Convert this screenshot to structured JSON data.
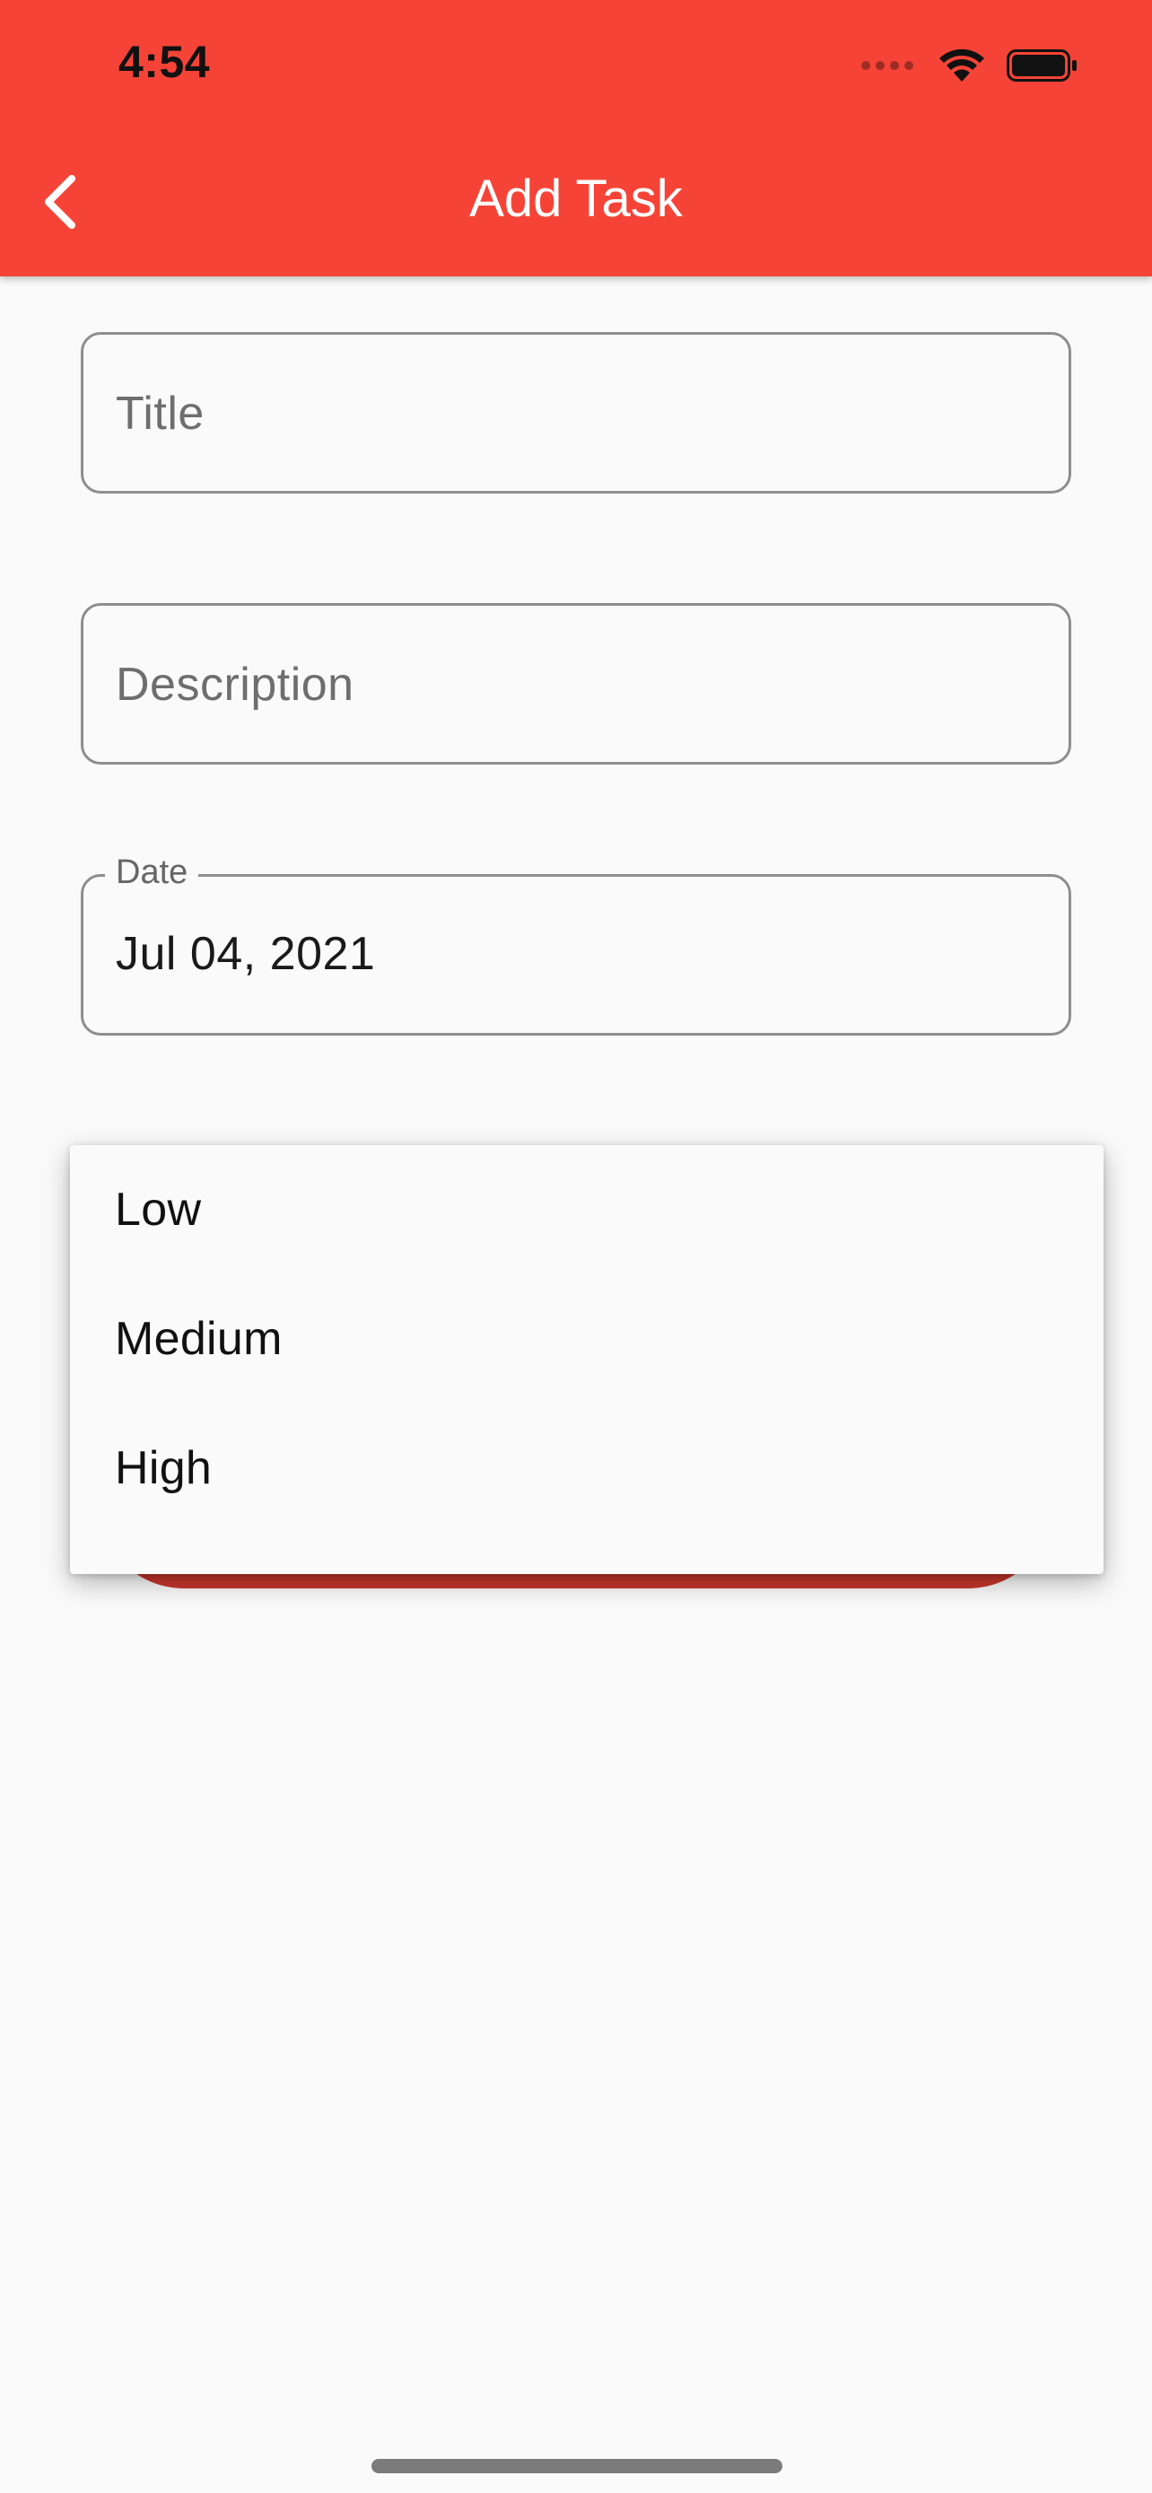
{
  "status_bar": {
    "time": "4:54",
    "icons": [
      "cellular-signal-icon",
      "wifi-icon",
      "battery-icon"
    ]
  },
  "app_bar": {
    "title": "Add Task",
    "back_icon": "chevron-left-icon",
    "color": "#f54437"
  },
  "form": {
    "title_field": {
      "placeholder": "Title",
      "value": ""
    },
    "description_field": {
      "placeholder": "Description",
      "value": ""
    },
    "date_field": {
      "label": "Date",
      "value": "Jul 04, 2021"
    }
  },
  "priority_dropdown": {
    "options": [
      "Low",
      "Medium",
      "High"
    ]
  },
  "colors": {
    "accent": "#f54437",
    "button_behind": "#c7362d",
    "background": "#fafafa"
  }
}
